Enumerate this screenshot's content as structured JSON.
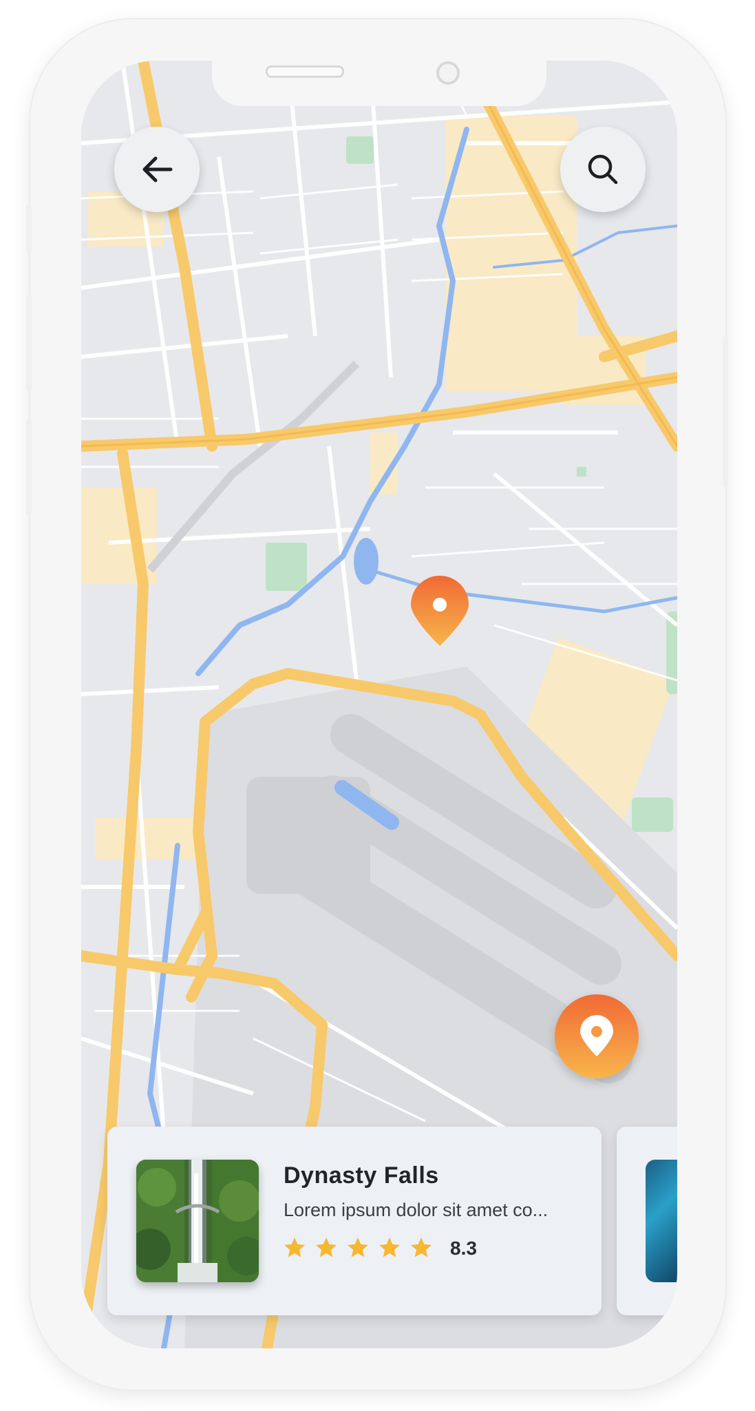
{
  "nav": {
    "back_icon": "arrow-left-icon",
    "search_icon": "search-icon"
  },
  "map": {
    "markers": [
      "map-pin-icon",
      "map-pin-icon"
    ]
  },
  "places": [
    {
      "title": "Dynasty Falls",
      "description": "Lorem ipsum dolor sit amet co...",
      "stars": 5,
      "rating": "8.3"
    }
  ],
  "colors": {
    "accent_top": "#f06a35",
    "accent_bottom": "#f8b54b",
    "star": "#f7b733",
    "road": "#f7c96a",
    "card_bg": "#edf0f4"
  }
}
